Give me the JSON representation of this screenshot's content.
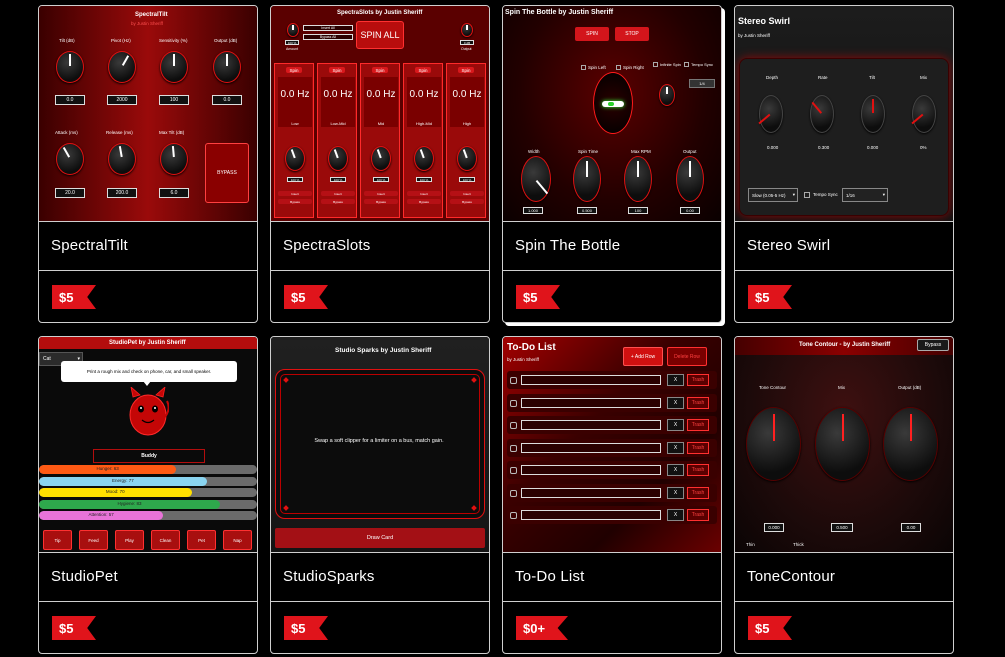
{
  "cards": [
    {
      "title": "SpectralTilt",
      "price": "$5",
      "thumb": {
        "plugin_title": "SpectralTilt",
        "author": "by Justin Sheriff",
        "knobs": [
          {
            "label": "Tilt (dB)",
            "value": "0.0"
          },
          {
            "label": "Pivot (Hz)",
            "value": "2000"
          },
          {
            "label": "Sensitivity (%)",
            "value": "100"
          },
          {
            "label": "Output (dB)",
            "value": "0.0"
          },
          {
            "label": "Attack (ms)",
            "value": "20.0"
          },
          {
            "label": "Release (ms)",
            "value": "200.0"
          },
          {
            "label": "Max Tilt (dB)",
            "value": "6.0"
          }
        ],
        "bypass": "BYPASS"
      }
    },
    {
      "title": "SpectraSlots",
      "price": "$5",
      "thumb": {
        "plugin_title": "SpectraSlots by Justin Sheriff",
        "spin_all": "SPIN ALL",
        "insert_all": "Insert All",
        "bypass_all": "Bypass All",
        "amount_label": "Amount",
        "output_label": "Output",
        "amount_value": "100 %",
        "output_value": "0 dB",
        "slots": [
          {
            "hz": "0.0 Hz",
            "band": "Low"
          },
          {
            "hz": "0.0 Hz",
            "band": "Low-Mid"
          },
          {
            "hz": "0.0 Hz",
            "band": "Mid"
          },
          {
            "hz": "0.0 Hz",
            "band": "High-Mid"
          },
          {
            "hz": "0.0 Hz",
            "band": "High"
          }
        ],
        "spin": "Spin",
        "pct": "100 %",
        "insert": "Insert",
        "bypass": "Bypass"
      }
    },
    {
      "title": "Spin The Bottle",
      "price": "$5",
      "thumb": {
        "plugin_title": "Spin The Bottle by Justin Sheriff",
        "spin": "SPIN",
        "stop": "STOP",
        "spin_left": "Spin Left",
        "spin_right": "Spin Right",
        "infinite": "Infinite Spin",
        "tempo_sync": "Tempo Sync",
        "rate": "1/4",
        "knobs": [
          {
            "label": "Width",
            "value": "1.000"
          },
          {
            "label": "Spin Time",
            "value": "0.500"
          },
          {
            "label": "Max RPM",
            "value": "100"
          },
          {
            "label": "Output",
            "value": "0.00"
          }
        ]
      }
    },
    {
      "title": "Stereo Swirl",
      "price": "$5",
      "thumb": {
        "plugin_title": "Stereo Swirl",
        "author": "by Justin Sheriff",
        "knobs": [
          {
            "label": "Depth",
            "value": "0.000"
          },
          {
            "label": "Rate",
            "value": "0.300"
          },
          {
            "label": "Tilt",
            "value": "0.000"
          },
          {
            "label": "Mix",
            "value": "0%"
          }
        ],
        "mode": "Slow (0.05-5 Hz)",
        "tempo_sync": "Tempo Sync",
        "division": "1/16"
      }
    },
    {
      "title": "StudioPet",
      "price": "$5",
      "thumb": {
        "plugin_title": "StudioPet by Justin Sheriff",
        "pet_type": "Cat",
        "speech": "Print a rough mix and check on phone, car, and small speaker.",
        "pet_name": "Buddy",
        "bars": [
          {
            "label": "Hunger: 63",
            "value": 0.63,
            "color": "#ff5a14"
          },
          {
            "label": "Energy: 77",
            "value": 0.77,
            "color": "#8ad4f0"
          },
          {
            "label": "Mood: 70",
            "value": 0.7,
            "color": "#ffe000"
          },
          {
            "label": "Hygiene: 83",
            "value": 0.83,
            "color": "#2ea84c"
          },
          {
            "label": "Attention: 57",
            "value": 0.57,
            "color": "#e873d8"
          }
        ],
        "buttons": [
          "Tip",
          "Feed",
          "Play",
          "Clean",
          "Pet",
          "Nap"
        ]
      }
    },
    {
      "title": "StudioSparks",
      "price": "$5",
      "thumb": {
        "plugin_title": "Studio Sparks by Justin Sheriff",
        "card_text": "Swap a soft clipper for a limiter on a bus, match gain.",
        "draw": "Draw Card"
      }
    },
    {
      "title": "To-Do List",
      "price": "$0+",
      "thumb": {
        "plugin_title": "To-Do List",
        "author": "by Justin Sheriff",
        "add_row": "+ Add Row",
        "delete_row": "Delete Row",
        "x": "X",
        "trash": "Trash"
      }
    },
    {
      "title": "ToneContour",
      "price": "$5",
      "thumb": {
        "plugin_title": "Tone Contour - by Justin Sheriff",
        "bypass": "Bypass",
        "knobs": [
          {
            "label": "Tone Contour",
            "value": "0.000"
          },
          {
            "label": "Mix",
            "value": "0.500"
          },
          {
            "label": "Output (dB)",
            "value": "0.00"
          }
        ],
        "thin": "Thin",
        "thick": "Thick"
      }
    }
  ]
}
